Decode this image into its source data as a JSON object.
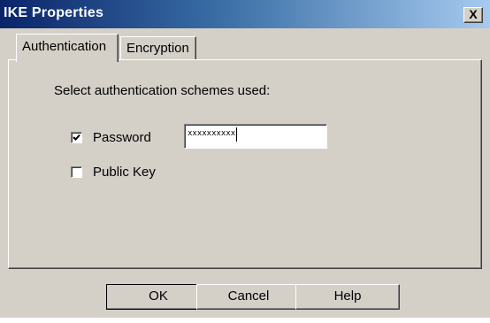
{
  "window": {
    "title": "IKE Properties",
    "close_symbol": "X"
  },
  "tabs": [
    {
      "label": "Authentication",
      "active": true
    },
    {
      "label": "Encryption",
      "active": false
    }
  ],
  "authentication": {
    "instruction": "Select authentication schemes used:",
    "password": {
      "label": "Password",
      "checked": true,
      "value": "xxxxxxxxxx"
    },
    "public_key": {
      "label": "Public Key",
      "checked": false
    }
  },
  "buttons": {
    "ok": "OK",
    "cancel": "Cancel",
    "help": "Help"
  },
  "colors": {
    "dialog_face": "#d4d0c8",
    "titlebar_start": "#0a246a",
    "titlebar_end": "#a6caf0"
  }
}
